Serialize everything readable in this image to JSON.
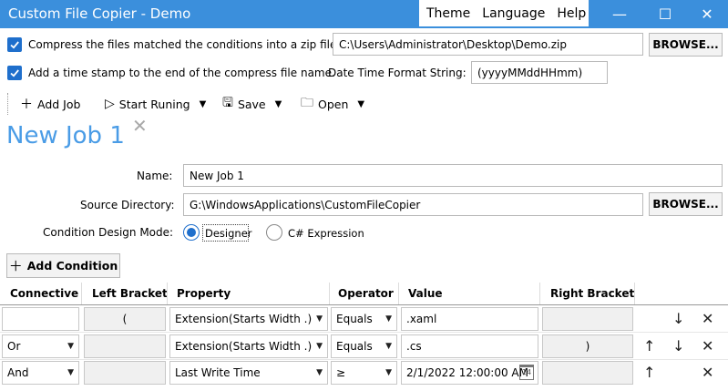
{
  "window": {
    "title": "Custom File Copier - Demo",
    "menu": [
      "Theme",
      "Language",
      "Help"
    ],
    "controls": {
      "minimize": "—",
      "maximize": "☐",
      "close": "✕"
    }
  },
  "options": {
    "compress_label": "Compress the files matched the conditions into a zip file:",
    "compress_path": "C:\\Users\\Administrator\\Desktop\\Demo.zip",
    "browse_label": "BROWSE...",
    "timestamp_label": "Add a time stamp to the end of the compress file name.",
    "format_label": "Date Time Format String:",
    "format_value": "(yyyyMMddHHmm)"
  },
  "toolbar": {
    "add_job": "Add Job",
    "start": "Start Runing",
    "save": "Save",
    "open": "Open"
  },
  "job": {
    "tab_title": "New Job 1",
    "name_label": "Name:",
    "name_value": "New Job 1",
    "source_label": "Source Directory:",
    "source_value": "G:\\WindowsApplications\\CustomFileCopier",
    "browse_label": "BROWSE...",
    "mode_label": "Condition Design Mode:",
    "mode_designer": "Designer",
    "mode_expression": "C# Expression",
    "add_condition": "Add Condition"
  },
  "grid": {
    "columns": [
      "Connective",
      "Left Bracket",
      "Property",
      "Operator",
      "Value",
      "Right Bracket"
    ],
    "rows": [
      {
        "connective": "",
        "left": "(",
        "property": "Extension(Starts Width .)",
        "operator": "Equals",
        "value": ".xaml",
        "right": "",
        "up": false,
        "down": true
      },
      {
        "connective": "Or",
        "left": "",
        "property": "Extension(Starts Width .)",
        "operator": "Equals",
        "value": ".cs",
        "right": ")",
        "up": true,
        "down": true
      },
      {
        "connective": "And",
        "left": "",
        "property": "Last Write Time",
        "operator": "≥",
        "value": "2/1/2022 12:00:00 AM",
        "right": "",
        "up": true,
        "down": false
      }
    ]
  }
}
